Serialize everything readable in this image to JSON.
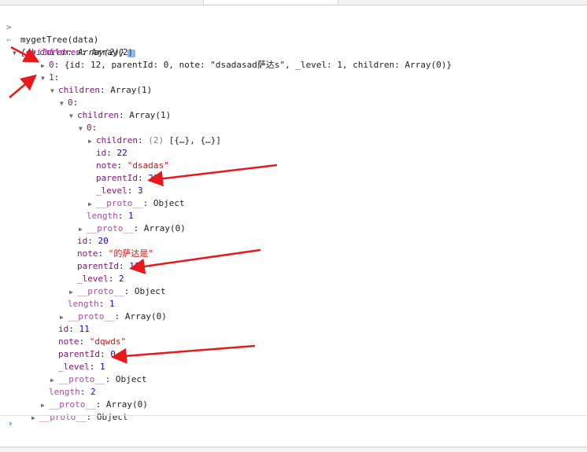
{
  "console": {
    "command": "mygetTree(data)",
    "result_summary_key": "children",
    "result_summary_value": "Array(2)",
    "info_badge": "i",
    "lines": {
      "l_children_root_key": "children",
      "l_children_root_val": "Array(2)",
      "l0_idx": "0",
      "l0_body": "{id: 12, parentId: 0, note: \"dsadasad萨达s\", _level: 1, children: Array(0)}",
      "l1_idx": "1",
      "l1_children_key": "children",
      "l1_children_val": "Array(1)",
      "l1_0_idx": "0",
      "l1_0_children_key": "children",
      "l1_0_children_val": "Array(1)",
      "l1_0_0_idx": "0",
      "deep_children_key": "children",
      "deep_children_count": "(2)",
      "deep_children_preview": "[{…}, {…}]",
      "deep_id_key": "id",
      "deep_id_val": "22",
      "deep_note_key": "note",
      "deep_note_val": "\"dsadas\"",
      "deep_parent_key": "parentId",
      "deep_parent_val": "20",
      "deep_level_key": "_level",
      "deep_level_val": "3",
      "deep_proto_key": "__proto__",
      "deep_proto_val": "Object",
      "arr3_length_key": "length",
      "arr3_length_val": "1",
      "arr3_proto_key": "__proto__",
      "arr3_proto_val": "Array(0)",
      "mid_id_key": "id",
      "mid_id_val": "20",
      "mid_note_key": "note",
      "mid_note_val": "\"的萨达是\"",
      "mid_parent_key": "parentId",
      "mid_parent_val": "11",
      "mid_level_key": "_level",
      "mid_level_val": "2",
      "mid_proto_key": "__proto__",
      "mid_proto_val": "Object",
      "arr2_length_key": "length",
      "arr2_length_val": "1",
      "arr2_proto_key": "__proto__",
      "arr2_proto_val": "Array(0)",
      "top_id_key": "id",
      "top_id_val": "11",
      "top_note_key": "note",
      "top_note_val": "\"dqwds\"",
      "top_parent_key": "parentId",
      "top_parent_val": "0",
      "top_level_key": "_level",
      "top_level_val": "1",
      "top_proto_key": "__proto__",
      "top_proto_val": "Object",
      "arr1_length_key": "length",
      "arr1_length_val": "2",
      "arr1_proto_key": "__proto__",
      "arr1_proto_val": "Array(0)",
      "root_proto_key": "__proto__",
      "root_proto_val": "Object"
    }
  },
  "colors": {
    "key": "#881280",
    "number": "#1c00cf",
    "string": "#c41a16",
    "annotation_arrow": "#e8191b"
  },
  "icons": {
    "expanded": "triangle-down-icon",
    "collapsed": "triangle-right-icon",
    "prompt": "chevron-right-icon",
    "result": "return-arrow-icon"
  }
}
